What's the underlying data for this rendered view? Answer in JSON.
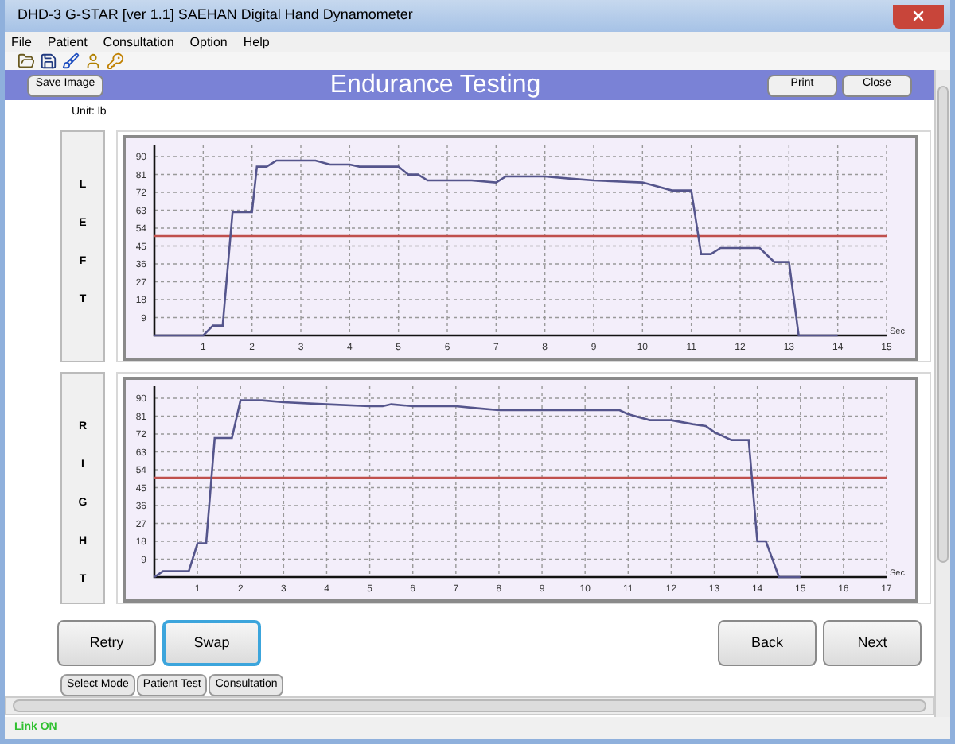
{
  "window": {
    "title": "DHD-3 G-STAR [ver 1.1] SAEHAN Digital Hand Dynamometer"
  },
  "menu": [
    "File",
    "Patient",
    "Consultation",
    "Option",
    "Help"
  ],
  "header": {
    "left_button": "Save Image",
    "title": "Endurance Testing",
    "right_buttons": [
      "Print",
      "Close"
    ]
  },
  "unit": "Unit: lb",
  "panels": [
    {
      "side": "LEFT",
      "chart_data": {
        "type": "line",
        "xlabel": "Sec",
        "x": [
          0,
          1.0,
          1.2,
          1.4,
          1.6,
          2.0,
          2.1,
          2.3,
          2.5,
          3.3,
          3.6,
          4.0,
          4.2,
          5.0,
          5.2,
          5.4,
          5.6,
          6.5,
          7.0,
          7.2,
          8.0,
          8.5,
          9.0,
          10.0,
          10.3,
          10.6,
          11.0,
          11.2,
          11.4,
          11.6,
          12.4,
          12.7,
          13.0,
          13.2,
          14.0
        ],
        "series": [
          {
            "color": "#55558c",
            "values": [
              0,
              0,
              5,
              5,
              62,
              62,
              85,
              85,
              88,
              88,
              86,
              86,
              85,
              85,
              81,
              81,
              78,
              78,
              77,
              80,
              80,
              79,
              78,
              77,
              75,
              73,
              73,
              41,
              41,
              44,
              44,
              37,
              37,
              0,
              0
            ]
          }
        ],
        "xlim": [
          0,
          15
        ],
        "ylim": [
          0,
          96
        ],
        "xticks": [
          1,
          2,
          3,
          4,
          5,
          6,
          7,
          8,
          9,
          10,
          11,
          12,
          13,
          14,
          15
        ],
        "yticks": [
          9,
          18,
          27,
          36,
          45,
          54,
          63,
          72,
          81,
          90
        ],
        "grid": true,
        "ref_lines": [
          {
            "axis": "y",
            "value": 50,
            "color": "#c0504d"
          }
        ]
      }
    },
    {
      "side": "RIGHT",
      "chart_data": {
        "type": "line",
        "xlabel": "Sec",
        "x": [
          0,
          0.2,
          0.8,
          1.0,
          1.2,
          1.4,
          1.8,
          2.0,
          2.5,
          3,
          4,
          5,
          5.3,
          5.5,
          6,
          7,
          7.5,
          8,
          9,
          10,
          10.8,
          11,
          11.5,
          12,
          12.5,
          12.8,
          13,
          13.4,
          13.8,
          14,
          14.2,
          14.5,
          15
        ],
        "series": [
          {
            "color": "#55558c",
            "values": [
              0,
              3,
              3,
              17,
              17,
              70,
              70,
              89,
              89,
              88,
              87,
              86,
              86,
              87,
              86,
              86,
              85,
              84,
              84,
              84,
              84,
              82,
              79,
              79,
              77,
              76,
              73,
              69,
              69,
              18,
              18,
              0,
              0
            ]
          }
        ],
        "xlim": [
          0,
          17
        ],
        "ylim": [
          0,
          96
        ],
        "xticks": [
          1,
          2,
          3,
          4,
          5,
          6,
          7,
          8,
          9,
          10,
          11,
          12,
          13,
          14,
          15,
          16,
          17
        ],
        "yticks": [
          9,
          18,
          27,
          36,
          45,
          54,
          63,
          72,
          81,
          90
        ],
        "grid": true,
        "ref_lines": [
          {
            "axis": "y",
            "value": 50,
            "color": "#c0504d"
          }
        ]
      }
    }
  ],
  "left_buttons": [
    {
      "label": "Retry",
      "focused": false
    },
    {
      "label": "Swap",
      "focused": true
    }
  ],
  "right_buttons": [
    {
      "label": "Back",
      "focused": false
    },
    {
      "label": "Next",
      "focused": false
    }
  ],
  "bottom_tabs": [
    "Select Mode",
    "Patient Test",
    "Consultation"
  ],
  "status_bar": "Link ON"
}
